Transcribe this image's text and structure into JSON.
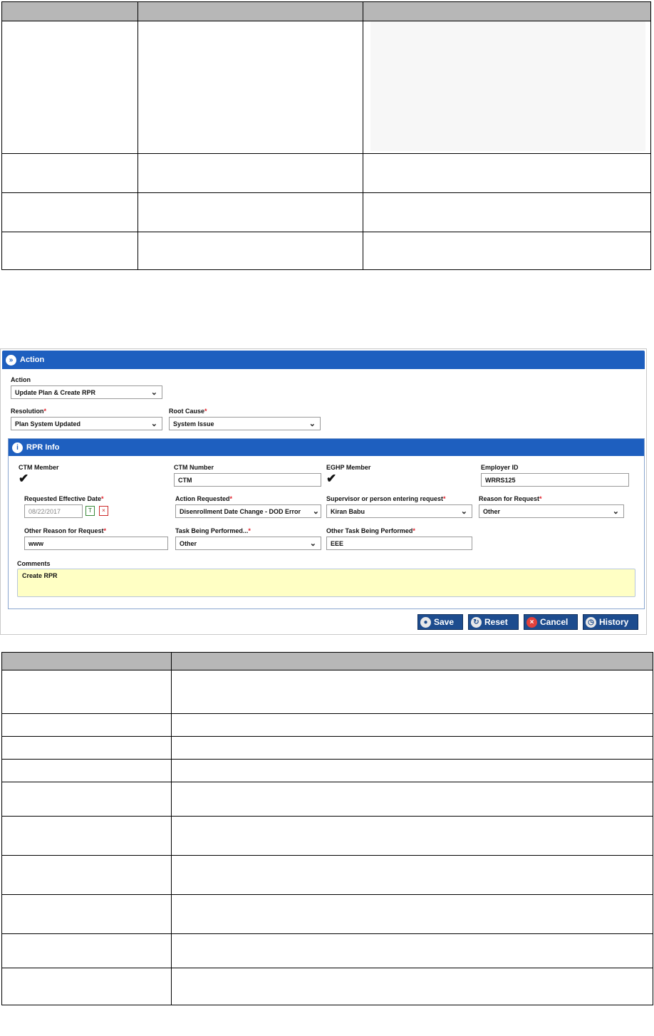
{
  "action_panel": {
    "header": "Action",
    "action_label": "Action",
    "action_value": "Update Plan & Create RPR",
    "resolution_label": "Resolution",
    "resolution_value": "Plan System Updated",
    "root_cause_label": "Root Cause",
    "root_cause_value": "System Issue",
    "required_mark": "*"
  },
  "rpr_info": {
    "header": "RPR Info",
    "ctm_member_label": "CTM Member",
    "ctm_member_checked": true,
    "ctm_number_label": "CTM Number",
    "ctm_number_value": "CTM",
    "eghp_member_label": "EGHP Member",
    "eghp_member_checked": true,
    "employer_id_label": "Employer ID",
    "employer_id_value": "WRRS125",
    "requested_effective_date_label": "Requested Effective Date",
    "requested_effective_date_value": "08/22/2017",
    "action_requested_label": "Action Requested",
    "action_requested_value": "Disenrollment Date Change - DOD Error",
    "supervisor_label": "Supervisor or person entering request",
    "supervisor_value": "Kiran Babu",
    "reason_label": "Reason for Request",
    "reason_value": "Other",
    "other_reason_label": "Other Reason for Request",
    "other_reason_value": "www",
    "task_label": "Task Being Performed...",
    "task_value": "Other",
    "other_task_label": "Other Task Being Performed",
    "other_task_value": "EEE",
    "comments_label": "Comments",
    "comments_value": "Create RPR"
  },
  "buttons": {
    "save": "Save",
    "reset": "Reset",
    "cancel": "Cancel",
    "history": "History"
  },
  "colors": {
    "header_blue": "#1e5fbf",
    "button_navy": "#1d4c8e",
    "required_red": "#e0202a",
    "comments_yellow": "#ffffc4",
    "table_header_gray": "#b7b7b7"
  }
}
